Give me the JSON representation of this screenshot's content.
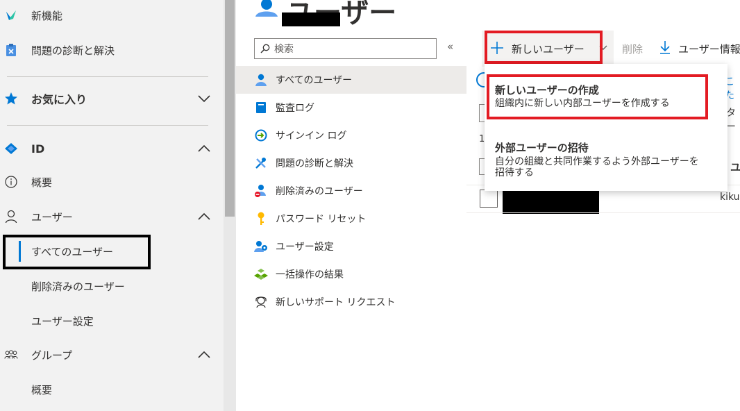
{
  "leftnav": {
    "whats_new": "新機能",
    "diagnose": "問題の診断と解決",
    "favorites": "お気に入り",
    "identity": "ID",
    "overview": "概要",
    "users": "ユーザー",
    "all_users": "すべてのユーザー",
    "deleted_users": "削除済みのユーザー",
    "user_settings": "ユーザー設定",
    "groups": "グループ",
    "groups_overview": "概要"
  },
  "page": {
    "title": "ユーザー"
  },
  "search": {
    "placeholder": "検索"
  },
  "collapse_label": "«",
  "menu": {
    "items": [
      {
        "label": "すべてのユーザー",
        "icon": "user-icon"
      },
      {
        "label": "監査ログ",
        "icon": "audit-log-icon"
      },
      {
        "label": "サインイン ログ",
        "icon": "signin-log-icon"
      },
      {
        "label": "問題の診断と解決",
        "icon": "wrench-icon"
      },
      {
        "label": "削除済みのユーザー",
        "icon": "deleted-user-icon"
      },
      {
        "label": "パスワード リセット",
        "icon": "key-icon"
      },
      {
        "label": "ユーザー設定",
        "icon": "user-settings-icon"
      },
      {
        "label": "一括操作の結果",
        "icon": "bulk-operations-icon"
      },
      {
        "label": "新しいサポート リクエスト",
        "icon": "support-icon"
      }
    ]
  },
  "toolbar": {
    "new_user": "新しいユーザー",
    "delete": "削除",
    "download": "ユーザー情報"
  },
  "background": {
    "info_link": "こた",
    "filter_text": "ター",
    "count": "1",
    "column_header": "ユ",
    "row_email": "kiku"
  },
  "dropdown": {
    "create_title": "新しいユーザーの作成",
    "create_desc": "組織内に新しい内部ユーザーを作成する",
    "invite_title": "外部ユーザーの招待",
    "invite_desc_line1": "自分の組織と共同作業するよう外部ユーザーを",
    "invite_desc_line2": "招待する"
  },
  "colors": {
    "accent": "#0078d4",
    "highlight_red": "#e31b23"
  }
}
